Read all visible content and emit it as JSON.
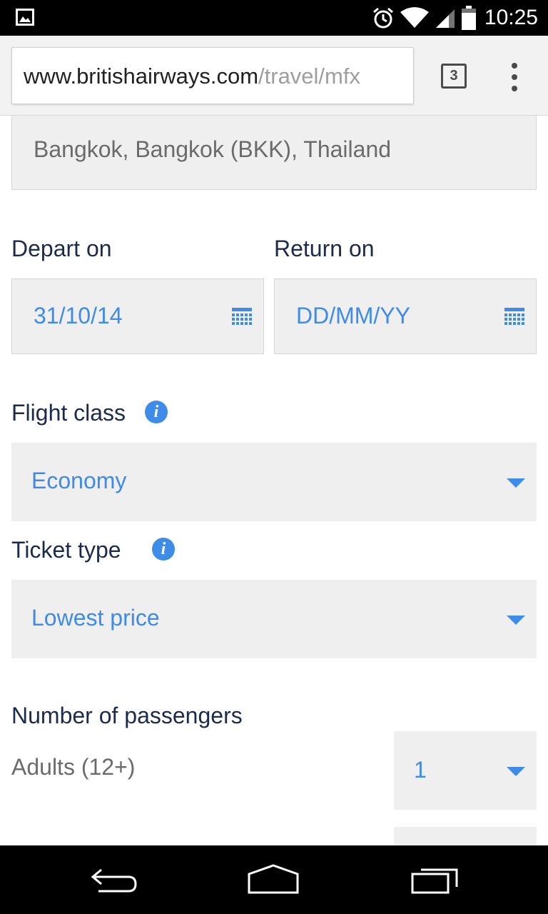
{
  "status_bar": {
    "time": "10:25",
    "icons": [
      "gallery-icon",
      "alarm-icon",
      "wifi-icon",
      "signal-icon",
      "battery-icon"
    ]
  },
  "browser": {
    "url_domain": "www.britishairways.com",
    "url_path": "/travel/mfx",
    "tab_count": "3",
    "menu_icon": "overflow-menu-icon"
  },
  "form": {
    "destination_value": "Bangkok, Bangkok (BKK), Thailand",
    "depart_label": "Depart on",
    "depart_value": "31/10/14",
    "return_label": "Return on",
    "return_placeholder": "DD/MM/YY",
    "flight_class_label": "Flight class",
    "flight_class_value": "Economy",
    "ticket_type_label": "Ticket type",
    "ticket_type_value": "Lowest price",
    "passengers_label": "Number of passengers",
    "adults_label": "Adults (12+)",
    "adults_value": "1"
  },
  "colors": {
    "accent": "#3f8be8",
    "label": "#1c2b4a",
    "field_bg": "#efefef"
  },
  "nav_bar": {
    "icons": [
      "back-icon",
      "home-icon",
      "recents-icon"
    ]
  }
}
